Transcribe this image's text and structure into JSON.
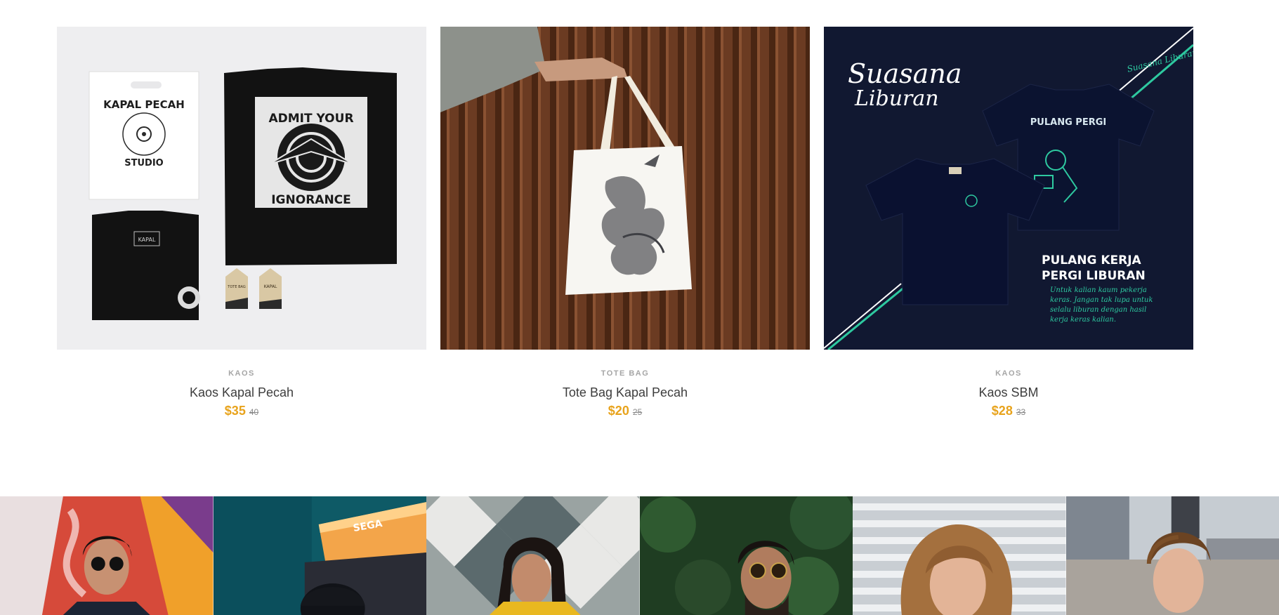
{
  "products": [
    {
      "category": "KAOS",
      "name": "Kaos Kapal Pecah",
      "price": "$35",
      "old_price": "40",
      "image": {
        "bag_text_top": "KAPAL PECAH",
        "bag_text_bottom": "STUDIO",
        "shirt_text_top": "ADMIT YOUR",
        "shirt_text_bottom": "IGNORANCE",
        "label_text": "KAPAL",
        "tag_left": "TOTE BAG",
        "tag_right": "KAPAL"
      }
    },
    {
      "category": "TOTE BAG",
      "name": "Tote Bag Kapal Pecah",
      "price": "$20",
      "old_price": "25",
      "image": {}
    },
    {
      "category": "KAOS",
      "name": "Kaos SBM",
      "price": "$28",
      "old_price": "33",
      "image": {
        "logo_line1": "Suasana",
        "logo_line2": "Liburan",
        "corner_logo": "Suasana Liburan",
        "shirt_title": "PULANG PERGI",
        "headline_line1": "PULANG KERJA",
        "headline_line2": "PERGI LIBURAN",
        "script_line1": "Untuk kalian kaum pekerja",
        "script_line2": "keras. Jangan tak lupa untuk",
        "script_line3": "selalu liburan dengan hasil",
        "script_line4": "kerja keras kalian."
      }
    }
  ],
  "gallery": {
    "arcade_sign": "SEGA"
  },
  "colors": {
    "accent_price": "#e8a31c",
    "navy": "#111831",
    "teal": "#2ec9a0",
    "wood": "#6b3b22"
  }
}
